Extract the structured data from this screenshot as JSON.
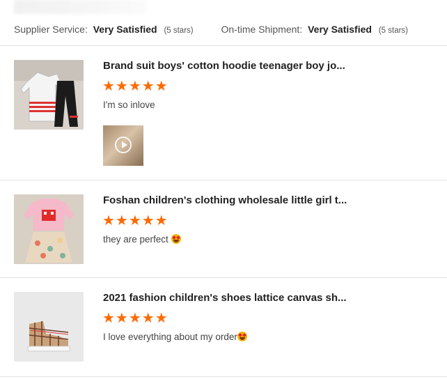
{
  "header": {
    "ratings": [
      {
        "label": "Supplier Service:",
        "value": "Very Satisfied",
        "count": "(5 stars)"
      },
      {
        "label": "On-time Shipment:",
        "value": "Very Satisfied",
        "count": "(5 stars)"
      }
    ]
  },
  "reviews": [
    {
      "product_title": "Brand suit boys' cotton hoodie teenager boy jo...",
      "stars": "★★★★★",
      "rating": 5,
      "comment": "I'm so inlove",
      "has_video": true,
      "thumb_icon": "hoodie-jogger-set"
    },
    {
      "product_title": "Foshan children's clothing wholesale little girl t...",
      "stars": "★★★★★",
      "rating": 5,
      "comment": "they are perfect ",
      "emoji_icon": "star-struck-emoji",
      "thumb_icon": "pink-sweater-skirt-set"
    },
    {
      "product_title": "2021 fashion children's shoes lattice canvas sh...",
      "stars": "★★★★★",
      "rating": 5,
      "comment": "I love everything about my order",
      "emoji_icon": "star-struck-emoji",
      "thumb_icon": "plaid-canvas-sneaker"
    }
  ],
  "colors": {
    "star": "#ff6a00",
    "divider": "#e3e3e3"
  }
}
